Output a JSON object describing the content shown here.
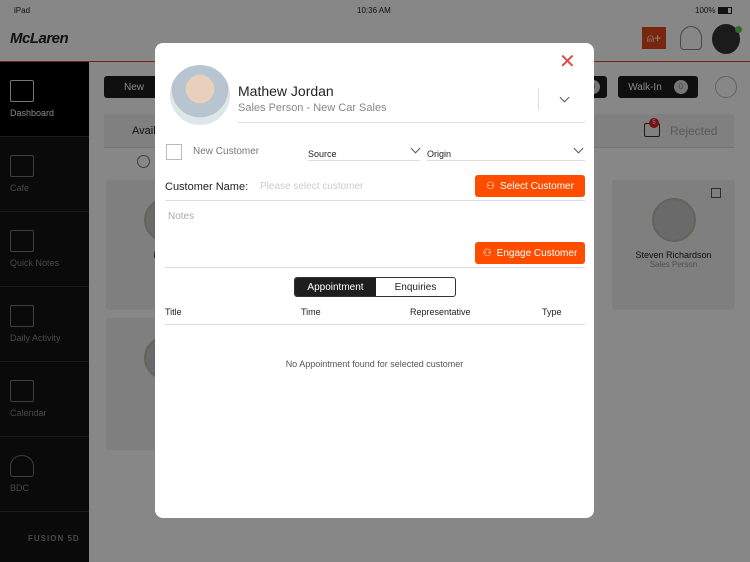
{
  "status_bar": {
    "device": "iPad",
    "time": "10:36 AM",
    "battery": "100%"
  },
  "header": {
    "logo": "McLaren",
    "add_user_icon": "user-plus-icon",
    "accent": "#e5491d"
  },
  "sidebar": {
    "items": [
      {
        "label": "Dashboard",
        "icon": "dashboard-icon"
      },
      {
        "label": "Cafe",
        "icon": "cup-icon"
      },
      {
        "label": "Quick Notes",
        "icon": "notes-icon"
      },
      {
        "label": "Daily Activity",
        "icon": "checklist-icon"
      },
      {
        "label": "Calendar",
        "icon": "calendar-icon"
      },
      {
        "label": "BDC",
        "icon": "person-icon"
      }
    ],
    "footer": "FUSION 5D"
  },
  "main": {
    "new_label": "New",
    "walkin_label": "Walk-In",
    "walkin_count": "0",
    "other_count": "0",
    "tab_available": "Avail",
    "tab_rejected": "Rejected",
    "rejected_badge": "5",
    "cards": [
      {
        "name": "Mathe",
        "role": "Sale"
      },
      {
        "name": "Stev",
        "role": "Sale"
      },
      {
        "name": "Steven Richardson",
        "role": "Sales Person"
      }
    ]
  },
  "modal": {
    "name": "Mathew Jordan",
    "role": "Sales Person - New Car Sales",
    "new_customer_label": "New Customer",
    "source_label": "Source",
    "origin_label": "Origin",
    "customer_name_label": "Customer Name:",
    "customer_name_placeholder": "Please select customer",
    "select_customer": "Select Customer",
    "notes_placeholder": "Notes",
    "engage_customer": "Engage Customer",
    "tabs": [
      "Appointment",
      "Enquiries"
    ],
    "columns": [
      "Title",
      "Time",
      "Representative",
      "Type"
    ],
    "empty": "No Appointment found for selected customer",
    "accent": "#ff4d00"
  }
}
